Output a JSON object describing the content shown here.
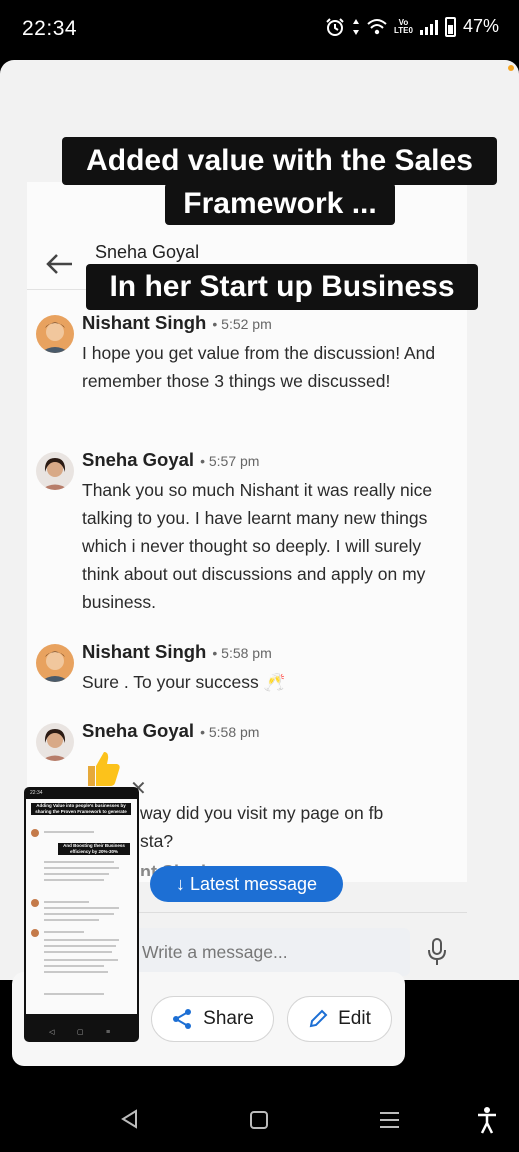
{
  "status_bar": {
    "time": "22:34",
    "battery": "47%",
    "volte_top": "Vo",
    "volte_bottom": "LTE0"
  },
  "overlay": {
    "title_line1": "Added value with the Sales",
    "title_line2": "Framework ...",
    "subtitle": "In her Start up Business"
  },
  "conversation": {
    "header_name": "Sneha Goyal",
    "messages": [
      {
        "sender": "Nishant Singh",
        "time": "• 5:52 pm",
        "text": "I hope you get value from the discussion! And remember those 3 things we discussed!"
      },
      {
        "sender": "Sneha Goyal",
        "time": "• 5:57 pm",
        "text": "Thank you so much Nishant it was really nice talking to you. I have learnt many new things which i never thought so deeply. I will surely think about out discussions and apply on my business."
      },
      {
        "sender": "Nishant Singh",
        "time": "• 5:58 pm",
        "text": "Sure . To your success 🥂"
      },
      {
        "sender": "Sneha Goyal",
        "time": "• 5:58 pm",
        "text": ""
      }
    ],
    "partial_line1": "way did you visit my page on fb",
    "partial_line2": "sta?",
    "partial_line3": "nt Singh",
    "latest_message_label": "↓ Latest message",
    "compose_placeholder": "Write a message..."
  },
  "actions": {
    "share_label": "Share",
    "edit_label": "Edit"
  },
  "mini_preview": {
    "title": "Adding Value into people's businesses by sharing the Proven Framework to generate Sales",
    "subtitle": "And Boosting their Business efficiency by 20%-30%"
  },
  "colors": {
    "accent": "#1d6fd4",
    "sheet_bg": "#f2f2f2",
    "overlay_bg": "#111111"
  }
}
